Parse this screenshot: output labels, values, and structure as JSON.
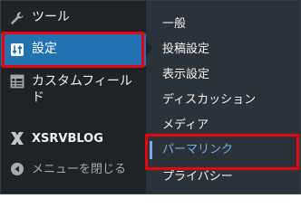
{
  "sidebar": {
    "items": [
      {
        "label": "ツール",
        "icon": "wrench-icon"
      },
      {
        "label": "設定",
        "icon": "settings-sliders-icon",
        "active": true
      },
      {
        "label": "カスタムフィールド",
        "icon": "table-grid-icon"
      },
      {
        "label": "XSRVBLOG",
        "icon": "x-logo-icon"
      },
      {
        "label": "メニューを閉じる",
        "icon": "collapse-arrow-icon"
      }
    ]
  },
  "submenu": {
    "items": [
      {
        "label": "一般"
      },
      {
        "label": "投稿設定"
      },
      {
        "label": "表示設定"
      },
      {
        "label": "ディスカッション"
      },
      {
        "label": "メディア"
      },
      {
        "label": "パーマリンク",
        "current": true
      },
      {
        "label": "プライバシー"
      }
    ]
  },
  "colors": {
    "sidebar_bg": "#1d2327",
    "submenu_bg": "#2c3338",
    "active_bg": "#2271b1",
    "current_text": "#72aee6",
    "highlight_border": "#e60012"
  }
}
